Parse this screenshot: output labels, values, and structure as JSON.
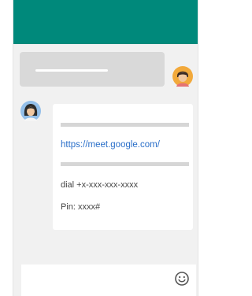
{
  "colors": {
    "app_bar": "#00897b",
    "background": "#f1f1f1",
    "link": "#2a6fc9"
  },
  "conversation": {
    "outgoing": {
      "avatar_icon": "user-avatar-icon"
    },
    "incoming": {
      "avatar_icon": "contact-avatar-icon",
      "link": "https://meet.google.com/",
      "dial": "dial +x-xxx-xxx-xxxx",
      "pin": "Pin: xxxx#"
    }
  },
  "compose": {
    "emoji_icon": "emoji-icon"
  }
}
